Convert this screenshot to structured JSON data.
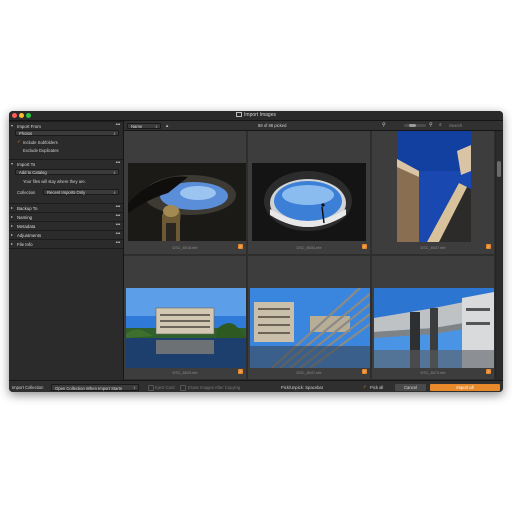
{
  "window": {
    "title": "Import Images"
  },
  "left_panel": {
    "import_from": {
      "title": "Import From",
      "source": "Photos",
      "include_subfolders": "Include Subfolders",
      "exclude_duplicates": "Exclude Duplicates"
    },
    "import_to": {
      "title": "Import To",
      "destination": "Add to Catalog",
      "note": "Your files will stay where they are.",
      "collection_label": "Collection",
      "collection_value": "Recent Imports Only"
    },
    "sections": [
      {
        "label": "Backup To"
      },
      {
        "label": "Naming"
      },
      {
        "label": "Metadata"
      },
      {
        "label": "Adjustments"
      },
      {
        "label": "File Info"
      }
    ]
  },
  "toolbar": {
    "sort_value": "Name",
    "sort_arrow": "▲",
    "count": "88 of 88 picked",
    "search_placeholder": "Search"
  },
  "grid": {
    "items": [
      {
        "filename": "DSC_8018.nfe",
        "picked": true
      },
      {
        "filename": "DSC_8034.nfe",
        "picked": true
      },
      {
        "filename": "DSC_8037.nfe",
        "picked": true
      },
      {
        "filename": "DSC_8043.nfe",
        "picked": true
      },
      {
        "filename": "DSC_8047.nfe",
        "picked": true
      },
      {
        "filename": "DSC_8074.nfe",
        "picked": true
      }
    ]
  },
  "bottom_bar": {
    "import_collection_label": "Import Collection",
    "import_collection_value": "Open Collection When Import Starts",
    "eject_card": "Eject Card",
    "erase_images": "Erase Images After Copying",
    "pick_hint": "Pick/Unpick: Spacebar",
    "pick_all": "Pick all",
    "cancel": "Cancel",
    "import_all": "Import all"
  },
  "colors": {
    "accent": "#e8892b",
    "background": "#262626"
  }
}
